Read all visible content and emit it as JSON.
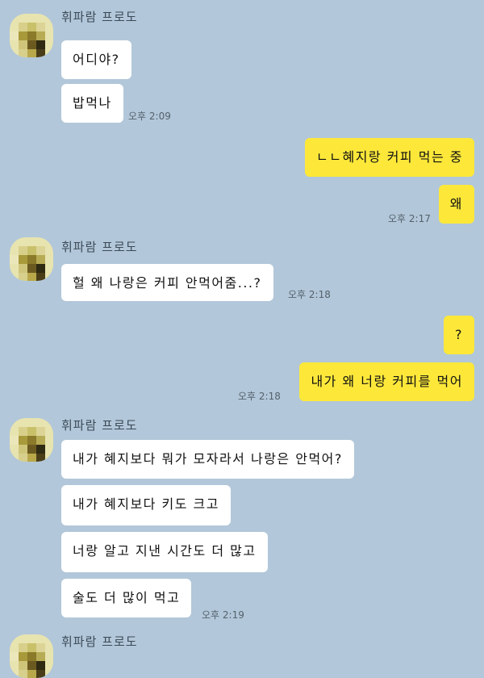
{
  "chat": {
    "colors": {
      "background": "#b2c7d9",
      "mine": "#fde83a",
      "theirs": "#ffffff"
    },
    "icons": {
      "avatar": "pixelated-avatar-icon"
    },
    "groups": [
      {
        "sender": "휘파람 프로도",
        "messages": [
          "어디야?",
          "밥먹나"
        ],
        "time": "오후 2:09"
      },
      {
        "mine": true,
        "messages": [
          "ㄴㄴ혜지랑 커피 먹는 중",
          "왜"
        ],
        "time": "오후 2:17"
      },
      {
        "sender": "휘파람 프로도",
        "messages": [
          "헐 왜 나랑은 커피 안먹어줌...?"
        ],
        "time": "오후 2:18"
      },
      {
        "mine": true,
        "messages": [
          "?",
          "내가 왜 너랑 커피를 먹어"
        ],
        "time": "오후 2:18"
      },
      {
        "sender": "휘파람 프로도",
        "messages": [
          "내가 혜지보다 뭐가 모자라서 나랑은 안먹어?",
          "내가 혜지보다 키도 크고",
          "너랑 알고 지낸 시간도 더 많고",
          "술도 더 많이 먹고"
        ],
        "time": "오후 2:19"
      },
      {
        "sender": "휘파람 프로도",
        "messages": []
      }
    ]
  }
}
